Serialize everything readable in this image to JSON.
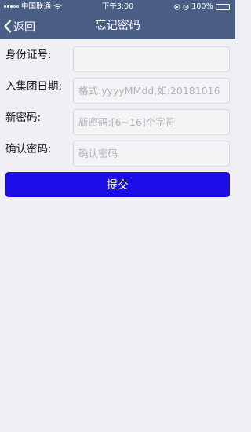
{
  "status_bar": {
    "carrier": "中国联通",
    "time": "下午3:00",
    "battery": "100%",
    "battery_level": 1.0
  },
  "nav": {
    "back_label": "返回",
    "title": "忘记密码"
  },
  "form": {
    "id_card": {
      "label": "身份证号:",
      "value": "",
      "placeholder": ""
    },
    "join_date": {
      "label": "入集团日期:",
      "value": "",
      "placeholder": "格式:yyyyMMdd,如:20181016"
    },
    "new_password": {
      "label": "新密码:",
      "value": "",
      "placeholder": "新密码:[6~16]个字符"
    },
    "confirm_password": {
      "label": "确认密码:",
      "value": "",
      "placeholder": "确认密码"
    }
  },
  "submit_label": "提交",
  "icons": {
    "signal": "signal-dots-icon",
    "wifi": "wifi-icon",
    "location": "location-icon",
    "alarm": "alarm-icon",
    "battery": "battery-icon",
    "back": "chevron-left-icon"
  },
  "colors": {
    "header": "#4a5e86",
    "background": "#efeff4",
    "submit_button": "#1b0ce8"
  }
}
